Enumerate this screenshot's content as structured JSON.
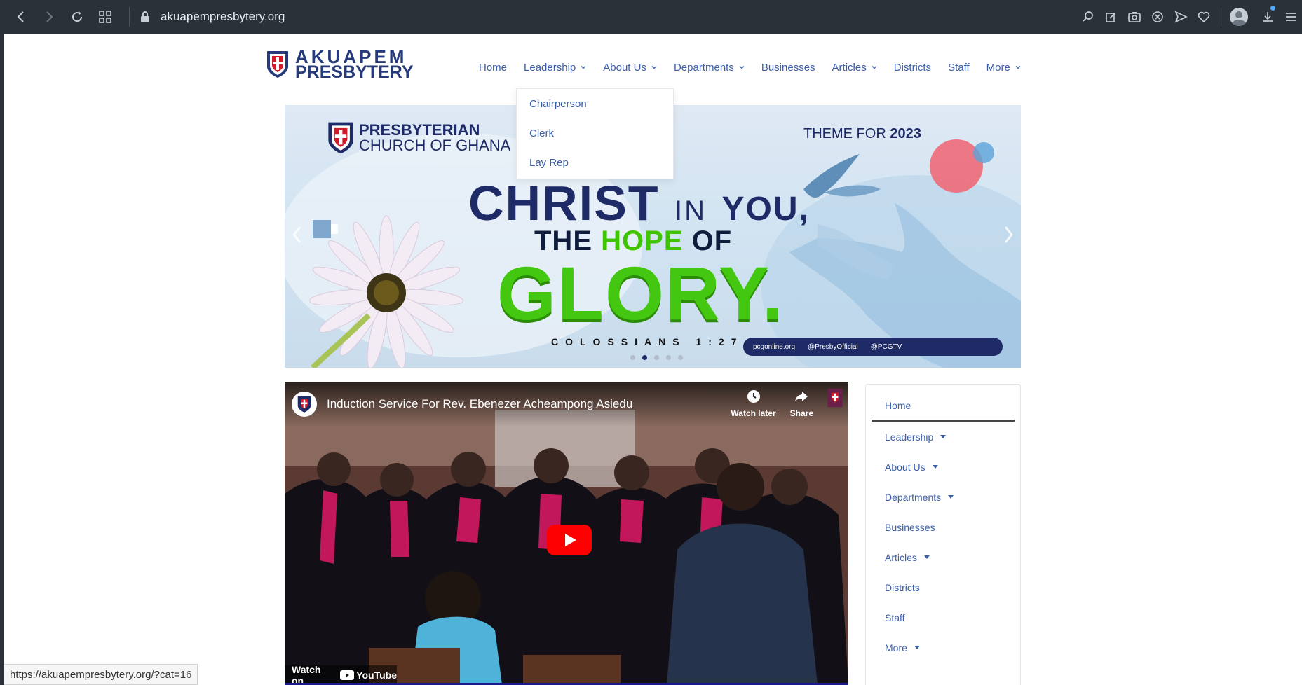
{
  "browser": {
    "url": "akuapempresbytery.org"
  },
  "site": {
    "logo_line1": "AKUAPEM",
    "logo_line2": "PRESBYTERY"
  },
  "nav": {
    "items": [
      {
        "label": "Home",
        "has_caret": false
      },
      {
        "label": "Leadership",
        "has_caret": true
      },
      {
        "label": "About Us",
        "has_caret": true
      },
      {
        "label": "Departments",
        "has_caret": true
      },
      {
        "label": "Businesses",
        "has_caret": false
      },
      {
        "label": "Articles",
        "has_caret": true
      },
      {
        "label": "Districts",
        "has_caret": false
      },
      {
        "label": "Staff",
        "has_caret": false
      },
      {
        "label": "More",
        "has_caret": true
      }
    ],
    "dropdown": [
      "Chairperson",
      "Clerk",
      "Lay Rep"
    ]
  },
  "hero": {
    "brand_line1": "PRESBYTERIAN",
    "brand_line2": "CHURCH OF GHANA",
    "theme_prefix": "THEME FOR",
    "theme_year": "2023",
    "headline_christ": "CHRIST",
    "headline_in": "IN",
    "headline_you": "YOU,",
    "headline_the": "THE",
    "headline_hope": "HOPE",
    "headline_of": "OF",
    "headline_glory": "GLORY.",
    "scripture": "COLOSSIANS 1:27",
    "social_site": "pcgonline.org",
    "social_handle": "@PresbyOfficial",
    "social_tv": "@PCGTV",
    "slide_count": 5,
    "active_slide": 2
  },
  "video": {
    "title": "Induction Service For Rev. Ebenezer Acheampong Asiedu",
    "watch_later": "Watch later",
    "share": "Share",
    "watch_on": "Watch on",
    "youtube": "YouTube"
  },
  "sidebar": {
    "items": [
      {
        "label": "Home",
        "has_caret": false,
        "active": true
      },
      {
        "label": "Leadership",
        "has_caret": true
      },
      {
        "label": "About Us",
        "has_caret": true
      },
      {
        "label": "Departments",
        "has_caret": true
      },
      {
        "label": "Businesses",
        "has_caret": false
      },
      {
        "label": "Articles",
        "has_caret": true
      },
      {
        "label": "Districts",
        "has_caret": false
      },
      {
        "label": "Staff",
        "has_caret": false
      },
      {
        "label": "More",
        "has_caret": true
      }
    ]
  },
  "status_url": "https://akuapempresbytery.org/?cat=16",
  "colors": {
    "chrome": "#2b3138",
    "link": "#3a5ea8",
    "brand_navy": "#1e2b66",
    "brand_green": "#43c710"
  }
}
